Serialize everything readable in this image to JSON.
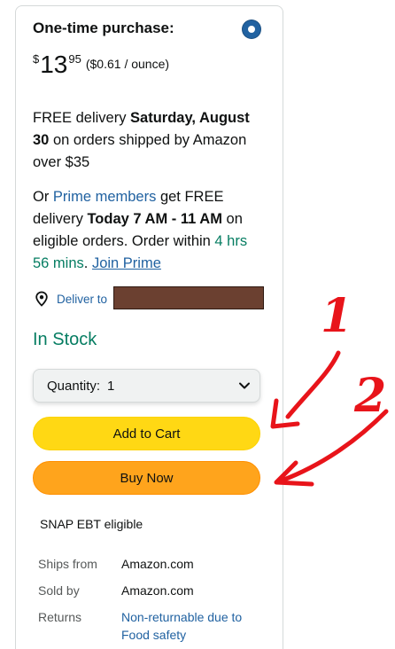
{
  "purchase": {
    "title": "One-time purchase:",
    "selected": true
  },
  "price": {
    "symbol": "$",
    "whole": "13",
    "fraction": "95",
    "unit_price": "($0.61 / ounce)"
  },
  "delivery_standard": {
    "part1": "FREE delivery ",
    "date": "Saturday, August 30",
    "part2": " on orders shipped by Amazon over $35"
  },
  "delivery_prime": {
    "prefix": "Or ",
    "prime_link": "Prime members",
    "part1": " get FREE delivery ",
    "window": "Today 7 AM - 11 AM",
    "part2": " on eligible orders. Order within ",
    "countdown": "4 hrs 56 mins",
    "part3": ". ",
    "join_link": "Join Prime"
  },
  "deliver_to": {
    "label": "Deliver to",
    "icon": "location-pin-icon"
  },
  "stock_status": "In Stock",
  "quantity": {
    "label": "Quantity:",
    "value": "1"
  },
  "buttons": {
    "add_to_cart": "Add to Cart",
    "buy_now": "Buy Now"
  },
  "snap_ebt": "SNAP EBT eligible",
  "details": [
    {
      "key": "Ships from",
      "value": "Amazon.com"
    },
    {
      "key": "Sold by",
      "value": "Amazon.com"
    },
    {
      "key": "Returns",
      "value": "Non-returnable due to Food safety"
    }
  ],
  "annotations": {
    "marker_1": "1",
    "marker_2": "2",
    "color": "#e8141a"
  },
  "colors": {
    "add_to_cart_bg": "#ffd814",
    "buy_now_bg": "#ffa41c",
    "link": "#2162a1",
    "in_stock": "#067d62",
    "radio": "#2162a1",
    "redaction": "#6b4030"
  }
}
